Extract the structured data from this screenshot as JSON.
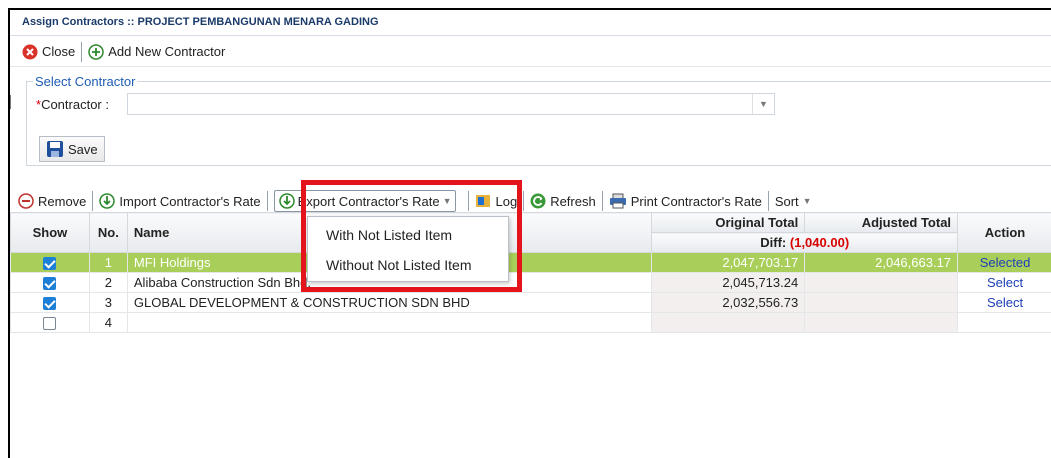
{
  "window": {
    "title": "Assign Contractors :: PROJECT PEMBANGUNAN MENARA GADING"
  },
  "toolbar1": {
    "close_label": "Close",
    "add_label": "Add New Contractor"
  },
  "select_contractor": {
    "legend": "Select Contractor",
    "required_mark": "*",
    "contractor_label": "Contractor :",
    "contractor_value": "",
    "save_label": "Save"
  },
  "toolbar2": {
    "remove_label": "Remove",
    "import_label": "Import Contractor's Rate",
    "export_label": "Export Contractor's Rate",
    "log_label": "Log",
    "refresh_label": "Refresh",
    "print_label": "Print Contractor's Rate",
    "sort_label": "Sort"
  },
  "export_menu": {
    "items": [
      "With Not Listed Item",
      "Without Not Listed Item"
    ]
  },
  "grid": {
    "headers": {
      "show": "Show",
      "no": "No.",
      "name": "Name",
      "original_total": "Original Total",
      "adjusted_total": "Adjusted Total",
      "diff_label": "Diff:",
      "diff_value": "(1,040.00)",
      "action": "Action"
    },
    "rows": [
      {
        "checked": true,
        "no": "1",
        "name": "MFI Holdings",
        "original": "2,047,703.17",
        "adjusted": "2,046,663.17",
        "action": "Selected"
      },
      {
        "checked": true,
        "no": "2",
        "name": "Alibaba Construction Sdn Bhd.",
        "original": "2,045,713.24",
        "adjusted": "",
        "action": "Select"
      },
      {
        "checked": true,
        "no": "3",
        "name": "GLOBAL DEVELOPMENT & CONSTRUCTION SDN BHD",
        "original": "2,032,556.73",
        "adjusted": "",
        "action": "Select"
      },
      {
        "checked": false,
        "no": "4",
        "name": "",
        "original": "",
        "adjusted": "",
        "action": ""
      }
    ]
  },
  "colors": {
    "accent": "#1e5cb3",
    "selected_row": "#a9cf5a",
    "highlight_box": "#e3141b",
    "diff": "#d80000"
  }
}
